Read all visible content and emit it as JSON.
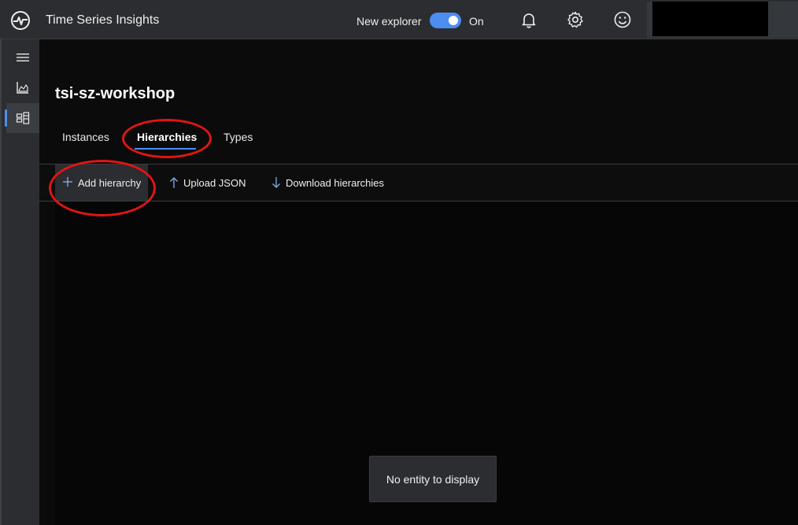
{
  "header": {
    "app_title": "Time Series Insights",
    "explorer_label": "New explorer",
    "toggle_state": "On",
    "toggle_on": true,
    "accent_color": "#4b8ef0"
  },
  "rail": {
    "items": [
      {
        "icon": "hamburger-menu-icon"
      },
      {
        "icon": "analyze-chart-icon"
      },
      {
        "icon": "model-icon",
        "active": true
      }
    ]
  },
  "main": {
    "environment_name": "tsi-sz-workshop",
    "tabs": [
      {
        "label": "Instances"
      },
      {
        "label": "Hierarchies",
        "selected": true
      },
      {
        "label": "Types"
      }
    ],
    "toolbar": {
      "add_label": "Add hierarchy",
      "upload_label": "Upload JSON",
      "download_label": "Download hierarchies"
    },
    "empty_message": "No entity to display"
  },
  "annotation_color": "#e01515"
}
